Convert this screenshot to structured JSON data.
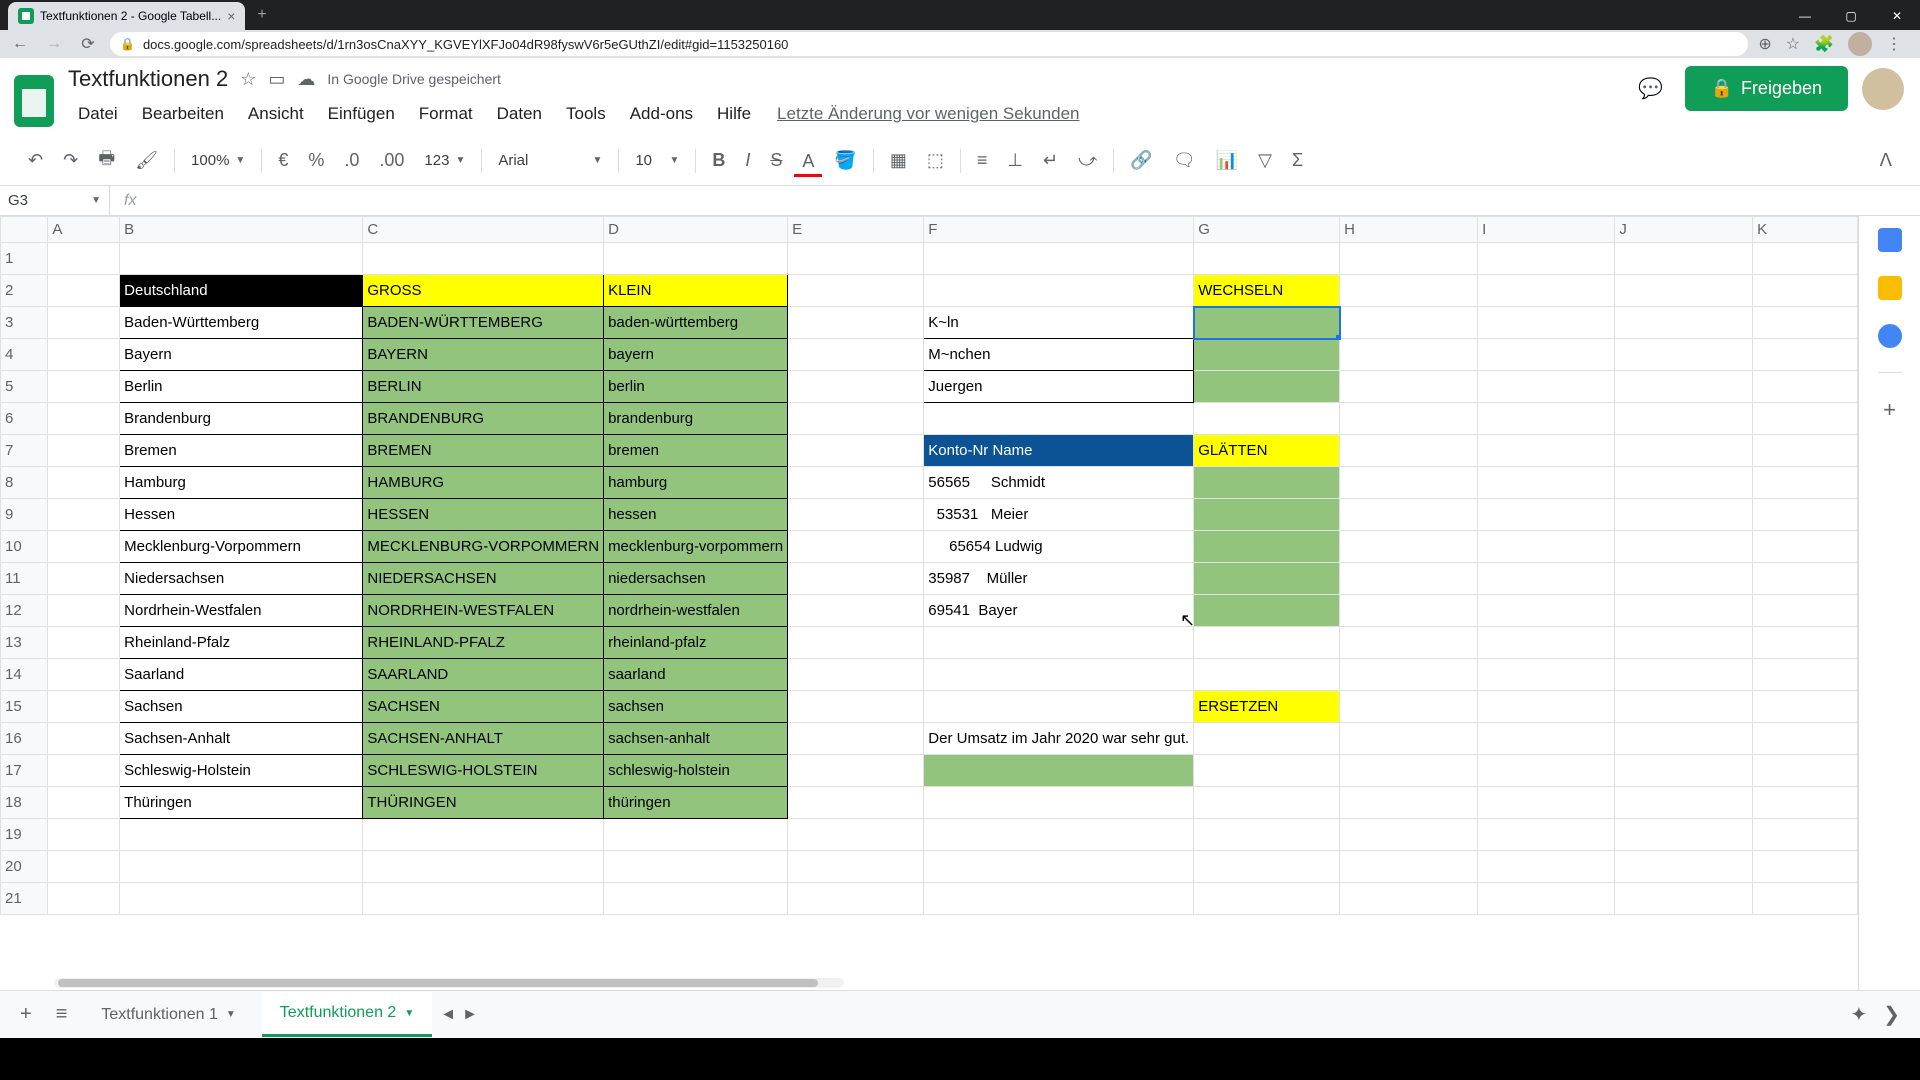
{
  "browser": {
    "tab_title": "Textfunktionen 2 - Google Tabell...",
    "url": "docs.google.com/spreadsheets/d/1rn3osCnaXYY_KGVEYlXFJo04dR98fyswV6r5eGUthZI/edit#gid=1153250160"
  },
  "doc": {
    "title": "Textfunktionen 2",
    "save_status": "In Google Drive gespeichert",
    "last_edit": "Letzte Änderung vor wenigen Sekunden",
    "share_label": "Freigeben"
  },
  "menu": {
    "file": "Datei",
    "edit": "Bearbeiten",
    "view": "Ansicht",
    "insert": "Einfügen",
    "format": "Format",
    "data": "Daten",
    "tools": "Tools",
    "addons": "Add-ons",
    "help": "Hilfe"
  },
  "toolbar": {
    "zoom": "100%",
    "currency": "€",
    "percent": "%",
    "dec_dec": ".0",
    "inc_dec": ".00",
    "num_format": "123",
    "font": "Arial",
    "font_size": "10"
  },
  "namebox": "G3",
  "formula": "",
  "col_headers": [
    "A",
    "B",
    "C",
    "D",
    "E",
    "F",
    "G",
    "H",
    "I",
    "J",
    "K"
  ],
  "rows": 21,
  "cells": {
    "B2": "Deutschland",
    "C2": "GROSS",
    "D2": "KLEIN",
    "B3": "Baden-Württemberg",
    "C3": "BADEN-WÜRTTEMBERG",
    "D3": "baden-württemberg",
    "B4": "Bayern",
    "C4": "BAYERN",
    "D4": "bayern",
    "B5": "Berlin",
    "C5": "BERLIN",
    "D5": "berlin",
    "B6": "Brandenburg",
    "C6": "BRANDENBURG",
    "D6": "brandenburg",
    "B7": "Bremen",
    "C7": "BREMEN",
    "D7": "bremen",
    "B8": "Hamburg",
    "C8": "HAMBURG",
    "D8": "hamburg",
    "B9": "Hessen",
    "C9": "HESSEN",
    "D9": "hessen",
    "B10": "Mecklenburg-Vorpommern",
    "C10": "MECKLENBURG-VORPOMMERN",
    "D10": "mecklenburg-vorpommern",
    "B11": "Niedersachsen",
    "C11": "NIEDERSACHSEN",
    "D11": "niedersachsen",
    "B12": "Nordrhein-Westfalen",
    "C12": "NORDRHEIN-WESTFALEN",
    "D12": "nordrhein-westfalen",
    "B13": "Rheinland-Pfalz",
    "C13": "RHEINLAND-PFALZ",
    "D13": "rheinland-pfalz",
    "B14": "Saarland",
    "C14": "SAARLAND",
    "D14": "saarland",
    "B15": "Sachsen",
    "C15": "SACHSEN",
    "D15": "sachsen",
    "B16": "Sachsen-Anhalt",
    "C16": "SACHSEN-ANHALT",
    "D16": "sachsen-anhalt",
    "B17": "Schleswig-Holstein",
    "C17": "SCHLESWIG-HOLSTEIN",
    "D17": "schleswig-holstein",
    "B18": "Thüringen",
    "C18": "THÜRINGEN",
    "D18": "thüringen",
    "G2": "WECHSELN",
    "F3": "K~ln",
    "F4": "M~nchen",
    "F5": "Juergen",
    "F7": "Konto-Nr Name",
    "G7": "GLÄTTEN",
    "F8": "56565     Schmidt",
    "F9": "  53531   Meier",
    "F10": "     65654 Ludwig",
    "F11": "35987    Müller",
    "F12": "69541  Bayer",
    "G15": "ERSETZEN",
    "F16": "Der Umsatz im Jahr 2020 war sehr gut."
  },
  "sheet_tabs": {
    "tab1": "Textfunktionen 1",
    "tab2": "Textfunktionen 2"
  }
}
